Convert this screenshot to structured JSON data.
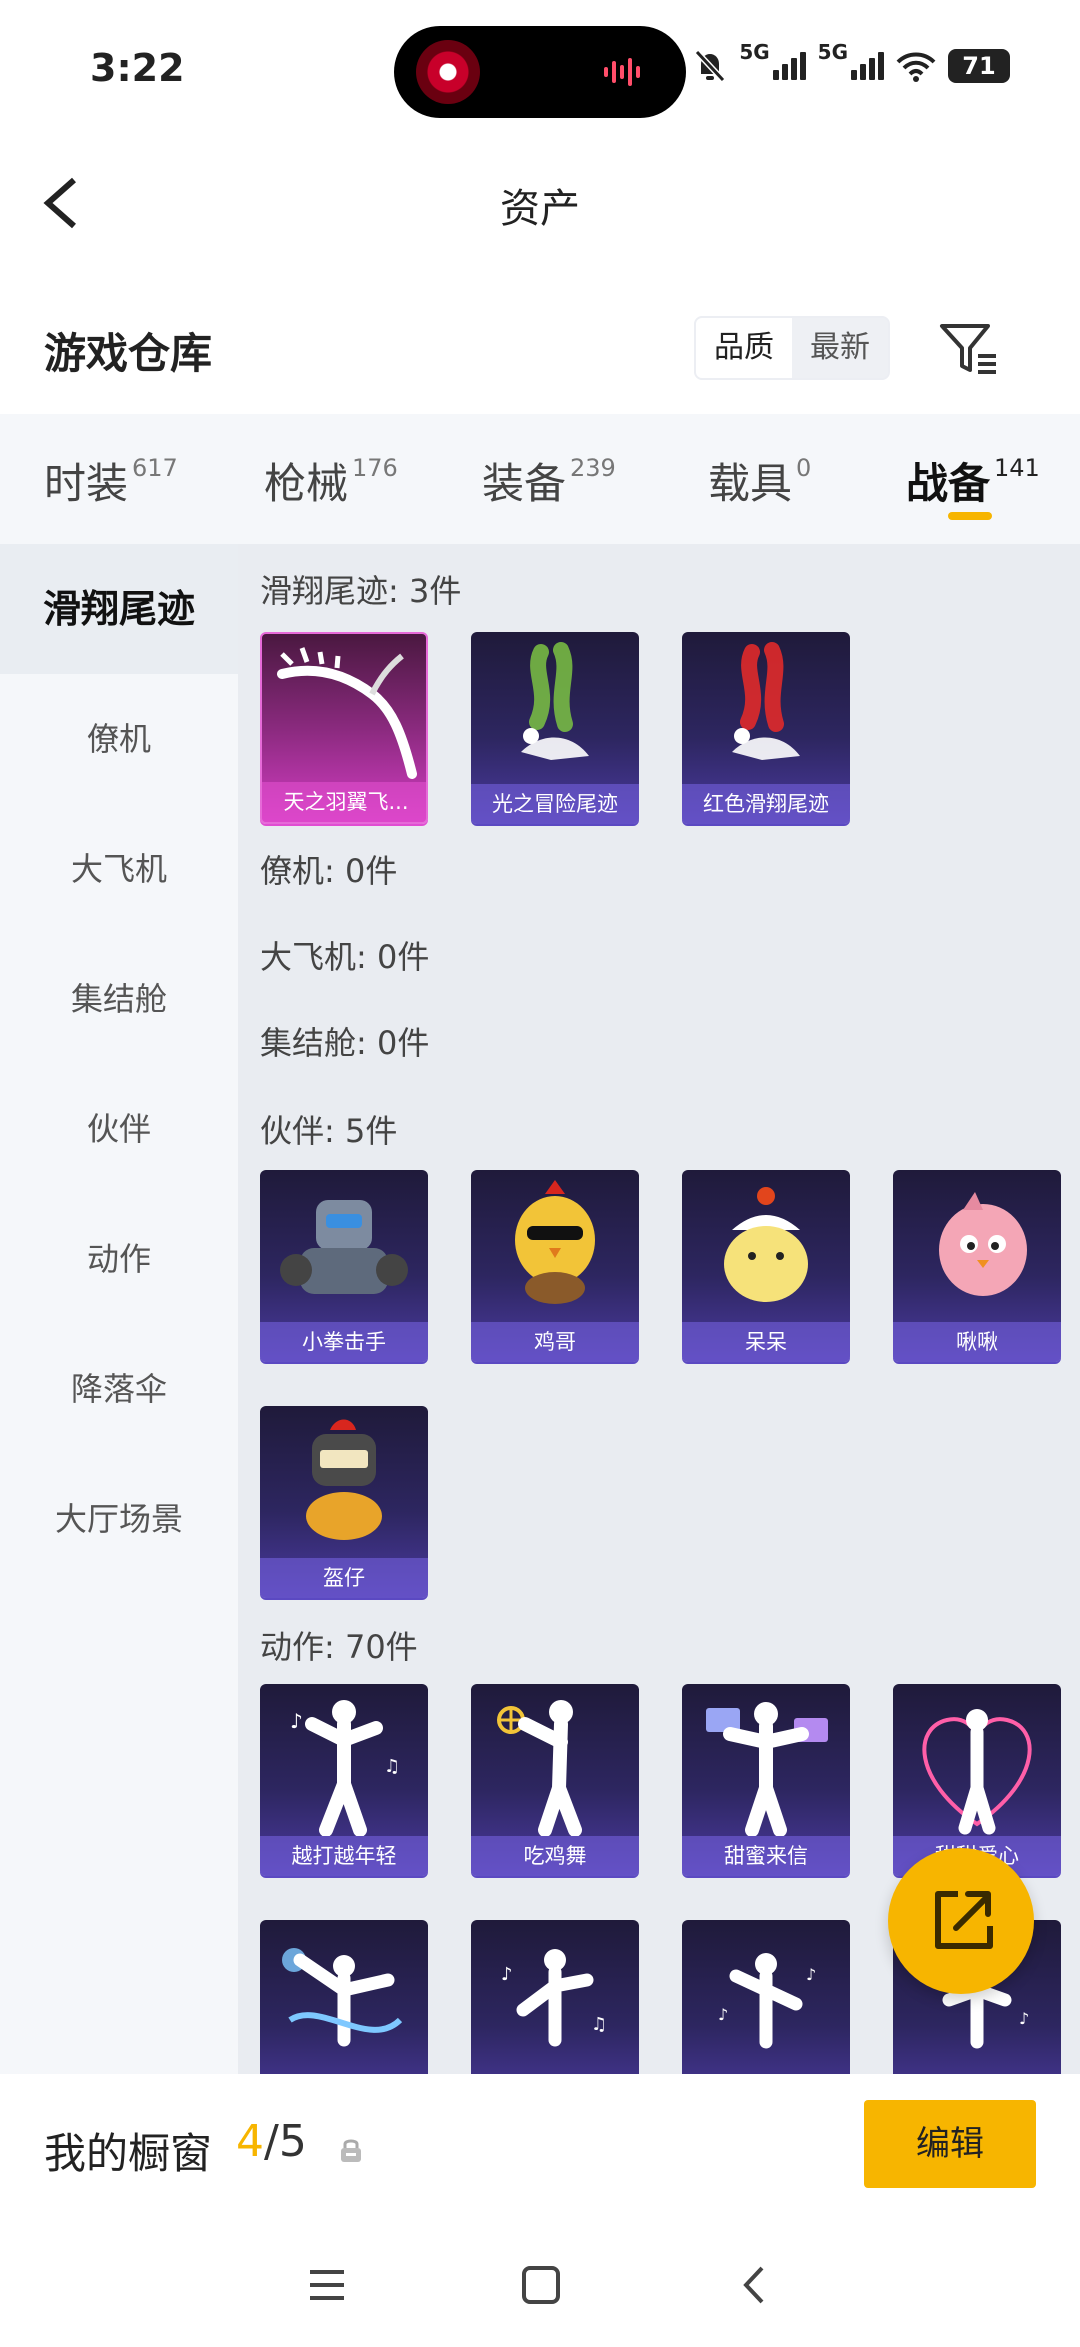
{
  "status_bar": {
    "time": "3:22",
    "signal_1": "5G",
    "signal_2": "5G",
    "battery": "71"
  },
  "header": {
    "title": "资产"
  },
  "warehouse": {
    "title": "游戏仓库",
    "sort_options": [
      "品质",
      "最新"
    ],
    "active_sort": "品质"
  },
  "category_tabs": [
    {
      "label": "时装",
      "count": "617"
    },
    {
      "label": "枪械",
      "count": "176"
    },
    {
      "label": "装备",
      "count": "239"
    },
    {
      "label": "载具",
      "count": "0"
    },
    {
      "label": "战备",
      "count": "141",
      "active": true
    }
  ],
  "sidebar": {
    "items": [
      "滑翔尾迹",
      "僚机",
      "大飞机",
      "集结舱",
      "伙伴",
      "动作",
      "降落伞",
      "大厅场景"
    ],
    "active": "滑翔尾迹"
  },
  "sections": {
    "glide_trail": {
      "label": "滑翔尾迹: 3件",
      "items": [
        "天之羽翼飞...",
        "光之冒险尾迹",
        "红色滑翔尾迹"
      ]
    },
    "wingman": {
      "label": "僚机: 0件"
    },
    "big_plane": {
      "label": "大飞机: 0件"
    },
    "assembly_pod": {
      "label": "集结舱: 0件"
    },
    "partner": {
      "label": "伙伴: 5件",
      "items": [
        "小拳击手",
        "鸡哥",
        "呆呆",
        "啾啾",
        "盔仔"
      ]
    },
    "emote": {
      "label": "动作: 70件",
      "items": [
        "越打越年轻",
        "吃鸡舞",
        "甜蜜来信",
        "甜甜爱心"
      ]
    }
  },
  "showcase": {
    "label": "我的橱窗",
    "current": "4",
    "total": "/5",
    "edit_label": "编辑"
  },
  "colors": {
    "accent": "#f7b500",
    "card_purple": "#4b3aa0",
    "card_pink": "#d23cc2"
  }
}
